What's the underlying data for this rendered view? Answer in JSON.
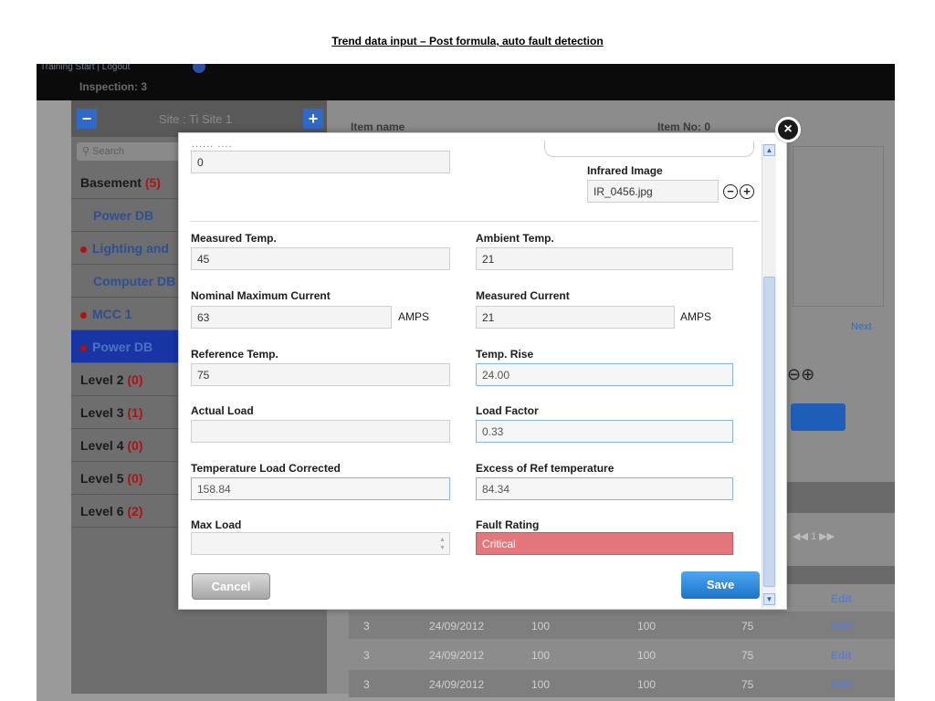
{
  "slide_title": "Trend data input – Post formula, auto fault detection",
  "background": {
    "topbar_links": "Training Start   |   Logout",
    "inspection_label": "Inspection: 3",
    "site_label": "Site : Ti Site 1",
    "search_placeholder": "Search",
    "nav": [
      {
        "label": "Basement",
        "count": "(5)",
        "type": "level"
      },
      {
        "label": "Power DB",
        "type": "sub"
      },
      {
        "label": "Lighting and",
        "type": "sub-fault"
      },
      {
        "label": "Computer DB",
        "type": "sub"
      },
      {
        "label": "MCC 1",
        "type": "sub-fault"
      },
      {
        "label": "Power DB",
        "type": "active-fault"
      },
      {
        "label": "Level 2",
        "count": "(0)",
        "type": "level"
      },
      {
        "label": "Level 3",
        "count": "(1)",
        "type": "level"
      },
      {
        "label": "Level 4",
        "count": "(0)",
        "type": "level"
      },
      {
        "label": "Level 5",
        "count": "(0)",
        "type": "level"
      },
      {
        "label": "Level 6",
        "count": "(2)",
        "type": "level"
      }
    ],
    "item_name_label": "Item name",
    "item_no_label": "Item No: 0",
    "next_label": "Next",
    "pager": "◀◀  1  ▶▶",
    "rows": [
      {
        "a": "3",
        "date": "24/09/2012",
        "b": "100",
        "c": "100",
        "d": "75",
        "edit": "Edit"
      },
      {
        "a": "3",
        "date": "24/09/2012",
        "b": "100",
        "c": "100",
        "d": "75",
        "edit": "Edit"
      },
      {
        "a": "3",
        "date": "24/09/2012",
        "b": "100",
        "c": "100",
        "d": "75",
        "edit": "Edit"
      }
    ],
    "edit_top": "Edit"
  },
  "modal": {
    "cut_label": "...... ....",
    "top_value": "0",
    "infrared_label": "Infrared Image",
    "infrared_value": "IR_0456.jpg",
    "measured_temp_label": "Measured Temp.",
    "measured_temp_value": "45",
    "ambient_temp_label": "Ambient Temp.",
    "ambient_temp_value": "21",
    "nominal_current_label": "Nominal Maximum Current",
    "nominal_current_value": "63",
    "measured_current_label": "Measured Current",
    "measured_current_value": "21",
    "amps_unit": "AMPS",
    "reference_temp_label": "Reference Temp.",
    "reference_temp_value": "75",
    "temp_rise_label": "Temp. Rise",
    "temp_rise_value": "24.00",
    "actual_load_label": "Actual Load",
    "actual_load_value": "",
    "load_factor_label": "Load Factor",
    "load_factor_value": "0.33",
    "temp_load_corrected_label": "Temperature Load Corrected",
    "temp_load_corrected_value": "158.84",
    "excess_ref_label": "Excess of Ref temperature",
    "excess_ref_value": "84.34",
    "max_load_label": "Max Load",
    "max_load_value": "",
    "fault_rating_label": "Fault Rating",
    "fault_rating_value": "Critical",
    "cancel_label": "Cancel",
    "save_label": "Save"
  },
  "colors": {
    "critical": "#e26c72",
    "save": "#2a8be0",
    "active_nav": "#1735a5"
  }
}
